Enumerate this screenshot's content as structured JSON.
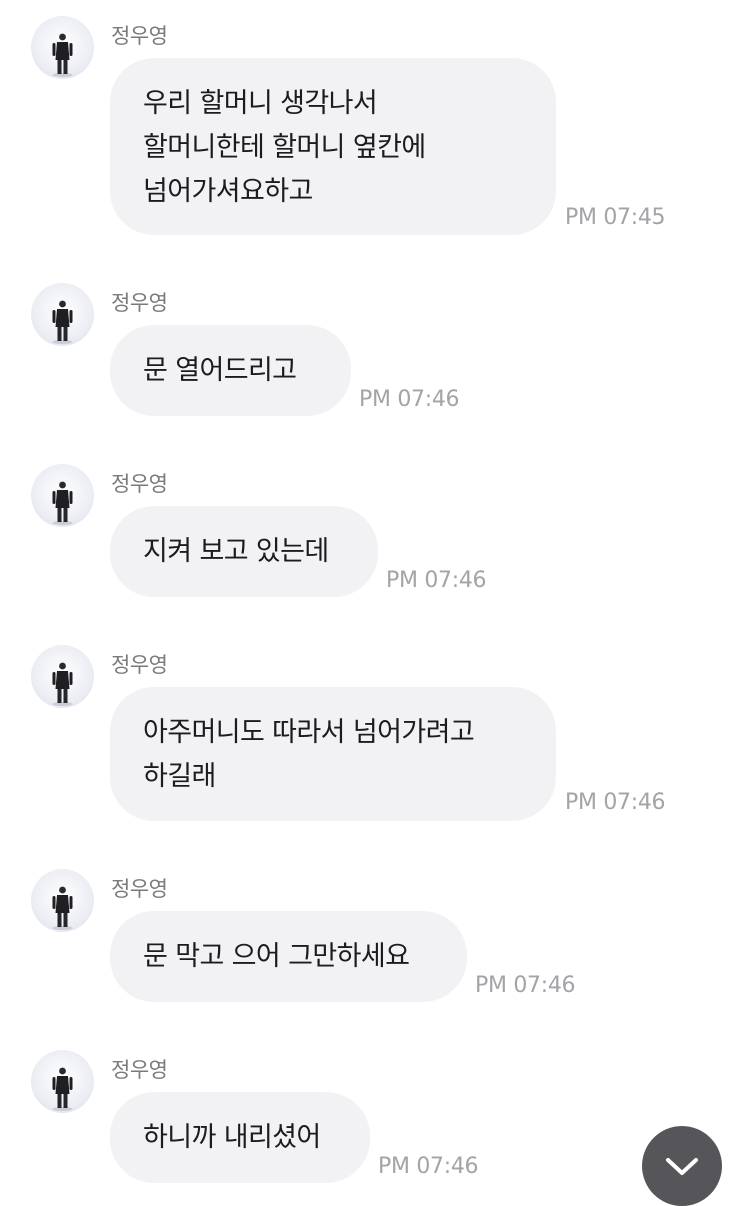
{
  "chat": {
    "messages": [
      {
        "sender": "정우영",
        "lines": [
          "우리 할머니 생각나서",
          "할머니한테 할머니 옆칸에",
          "넘어가셔요하고"
        ],
        "time": "PM 07:45"
      },
      {
        "sender": "정우영",
        "lines": [
          "문 열어드리고"
        ],
        "time": "PM 07:46"
      },
      {
        "sender": "정우영",
        "lines": [
          "지켜 보고 있는데"
        ],
        "time": "PM 07:46"
      },
      {
        "sender": "정우영",
        "lines": [
          "아주머니도 따라서 넘어가려고",
          "하길래"
        ],
        "time": "PM 07:46"
      },
      {
        "sender": "정우영",
        "lines": [
          "문 막고 으어 그만하세요"
        ],
        "time": "PM 07:46"
      },
      {
        "sender": "정우영",
        "lines": [
          "하니까 내리셨어"
        ],
        "time": "PM 07:46"
      }
    ],
    "scroll_button_icon": "chevron-down-icon"
  }
}
